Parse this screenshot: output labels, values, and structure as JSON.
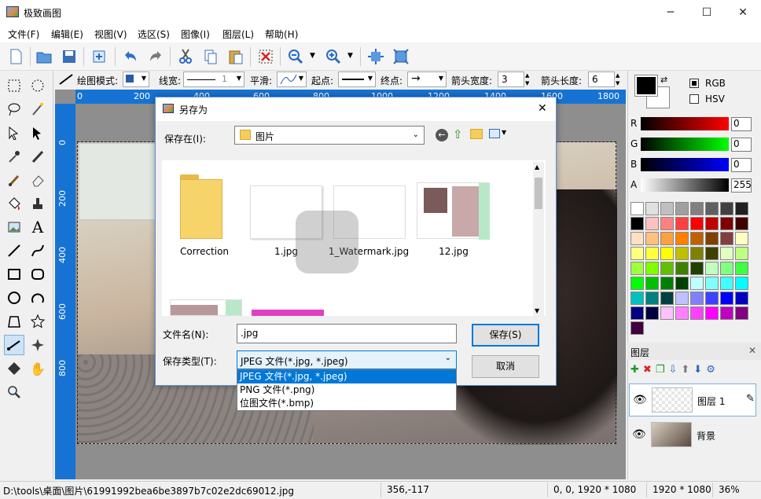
{
  "window": {
    "title": "极致画图",
    "min": "─",
    "max": "☐",
    "close": "✕"
  },
  "menu": [
    "文件(F)",
    "编辑(E)",
    "视图(V)",
    "选区(S)",
    "图像(I)",
    "图层(L)",
    "帮助(H)"
  ],
  "options": {
    "draw_mode_label": "绘图模式:",
    "line_width_label": "线宽:",
    "line_width_value": "1",
    "smooth_label": "平滑:",
    "start_label": "起点:",
    "end_label": "终点:",
    "arrow_width_label": "箭头宽度:",
    "arrow_width_value": "3",
    "arrow_length_label": "箭头长度:",
    "arrow_length_value": "6"
  },
  "ruler": {
    "h": [
      "0",
      "200",
      "400",
      "600",
      "800",
      "1000",
      "1200",
      "1400",
      "1600",
      "1800"
    ],
    "v": [
      "0",
      "200",
      "400",
      "600",
      "800"
    ]
  },
  "color_panel": {
    "mode_rgb": "RGB",
    "mode_hsv": "HSV",
    "r_label": "R",
    "g_label": "G",
    "b_label": "B",
    "a_label": "A",
    "r": "0",
    "g": "0",
    "b": "0",
    "a": "255",
    "palette": [
      "#ffffff",
      "#e0e0e0",
      "#c0c0c0",
      "#a0a0a0",
      "#808080",
      "#606060",
      "#404040",
      "#202020",
      "#000000",
      "#ffc0c0",
      "#ff8080",
      "#ff4040",
      "#ff0000",
      "#c00000",
      "#800000",
      "#400000",
      "#ffe0c0",
      "#ffc080",
      "#ffa040",
      "#ff8000",
      "#c06000",
      "#804000",
      "#804040",
      "#ffffc0",
      "#ffff80",
      "#ffff40",
      "#ffff00",
      "#c0c000",
      "#808000",
      "#404000",
      "#e0ffc0",
      "#c0ff80",
      "#a0ff40",
      "#80ff00",
      "#60c000",
      "#408000",
      "#204000",
      "#c0ffc0",
      "#80ff80",
      "#40ff40",
      "#00ff00",
      "#00c000",
      "#008000",
      "#004000",
      "#c0ffff",
      "#80ffff",
      "#40ffff",
      "#00ffff",
      "#00c0c0",
      "#008080",
      "#004040",
      "#c0c0ff",
      "#8080ff",
      "#4040ff",
      "#0000ff",
      "#0000c0",
      "#000080",
      "#000040",
      "#ffc0ff",
      "#ff80ff",
      "#ff40ff",
      "#ff00ff",
      "#c000c0",
      "#800080",
      "#400040"
    ]
  },
  "layers": {
    "title": "图层",
    "items": [
      {
        "name": "图层 1"
      },
      {
        "name": "背景"
      }
    ]
  },
  "dialog": {
    "title": "另存为",
    "save_in_label": "保存在(I):",
    "save_in_value": "图片",
    "filename_label": "文件名(N):",
    "filename_value": ".jpg",
    "filetype_label": "保存类型(T):",
    "filetype_value": "JPEG 文件(*.jpg, *.jpeg)",
    "save_button": "保存(S)",
    "cancel_button": "取消",
    "files": [
      "Correction",
      "1.jpg",
      "1_Watermark.jpg",
      "12.jpg"
    ],
    "types": [
      "JPEG 文件(*.jpg, *.jpeg)",
      "PNG 文件(*.png)",
      "位图文件(*.bmp)"
    ]
  },
  "status": {
    "path": "D:\\tools\\桌面\\图片\\61991992bea6be3897b7c02e2dc69012.jpg",
    "cursor": "356,-117",
    "selection": "0, 0, 1920 * 1080",
    "size": "1920 * 1080",
    "zoom": "36%"
  }
}
